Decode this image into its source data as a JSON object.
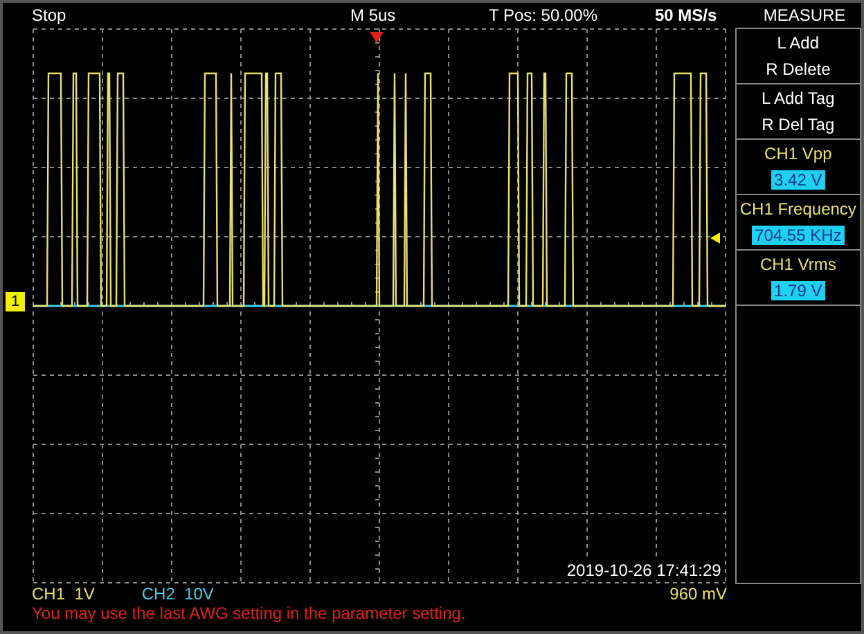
{
  "status": {
    "run_state": "Stop",
    "timebase": "M 5us",
    "trigger_position": "T Pos: 50.00%",
    "sample_rate": "50 MS/s"
  },
  "measure": {
    "title": "MEASURE",
    "items": [
      {
        "kind": "action",
        "lines": [
          "L Add",
          "R Delete"
        ]
      },
      {
        "kind": "action",
        "lines": [
          "L Add Tag",
          "R Del Tag"
        ]
      },
      {
        "kind": "reading",
        "label": "CH1 Vpp",
        "value": "3.42 V"
      },
      {
        "kind": "reading",
        "label": "CH1 Frequency",
        "value": "704.55 KHz"
      },
      {
        "kind": "reading",
        "label": "CH1 Vrms",
        "value": "1.79 V"
      }
    ]
  },
  "channel_marker": "1",
  "timestamp": "2019-10-26 17:41:29",
  "channels": [
    {
      "label": "CH1",
      "scale": "1V",
      "color": "#e8e070"
    },
    {
      "label": "CH2",
      "scale": "10V",
      "color": "#40d0e8"
    }
  ],
  "trigger_level": "960 mV",
  "message": "You may use the last AWG setting in the parameter setting."
}
